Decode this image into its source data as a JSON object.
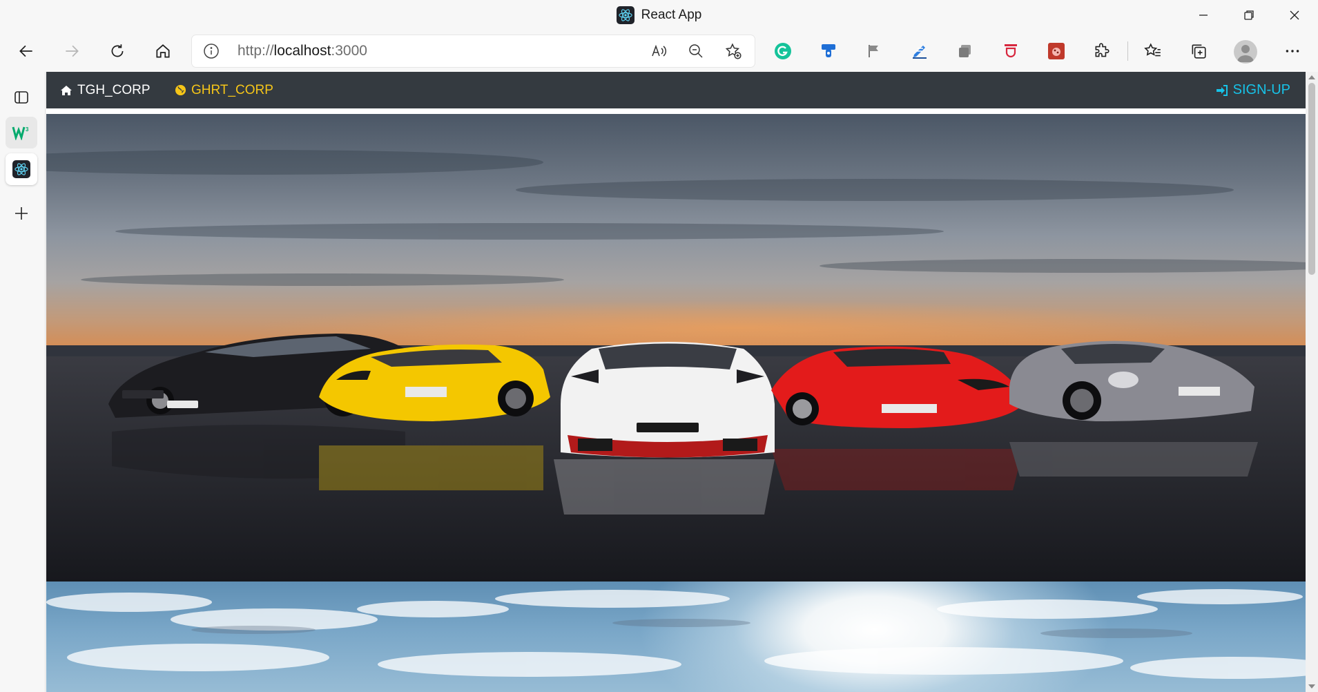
{
  "window": {
    "title": "React App"
  },
  "address_bar": {
    "url_prefix": "http://",
    "url_host": "localhost",
    "url_port": ":3000"
  },
  "navbar": {
    "brand_label": "TGH_CORP",
    "link_label": "GHRT_CORP",
    "signup_label": "SIGN-UP"
  },
  "colors": {
    "navbar_bg": "#343a40",
    "link_accent": "#f5c518",
    "signup_accent": "#17c3e8"
  },
  "icons": {
    "toolbar": [
      "back-icon",
      "forward-icon",
      "refresh-icon",
      "home-icon"
    ],
    "address": [
      "info-icon",
      "read-aloud-icon",
      "zoom-out-icon",
      "add-favorite-icon"
    ],
    "extensions": [
      "grammarly-icon",
      "extension-blue-icon",
      "flag-icon",
      "pen-icon",
      "extension-gray-icon",
      "extension-red-icon",
      "extension-bug-icon",
      "puzzle-icon"
    ],
    "right": [
      "favorites-icon",
      "collections-icon",
      "profile-avatar",
      "more-icon"
    ],
    "sidebar": [
      "tab-actions-icon",
      "w3schools-tab-icon",
      "react-tab-icon",
      "new-tab-icon"
    ]
  }
}
